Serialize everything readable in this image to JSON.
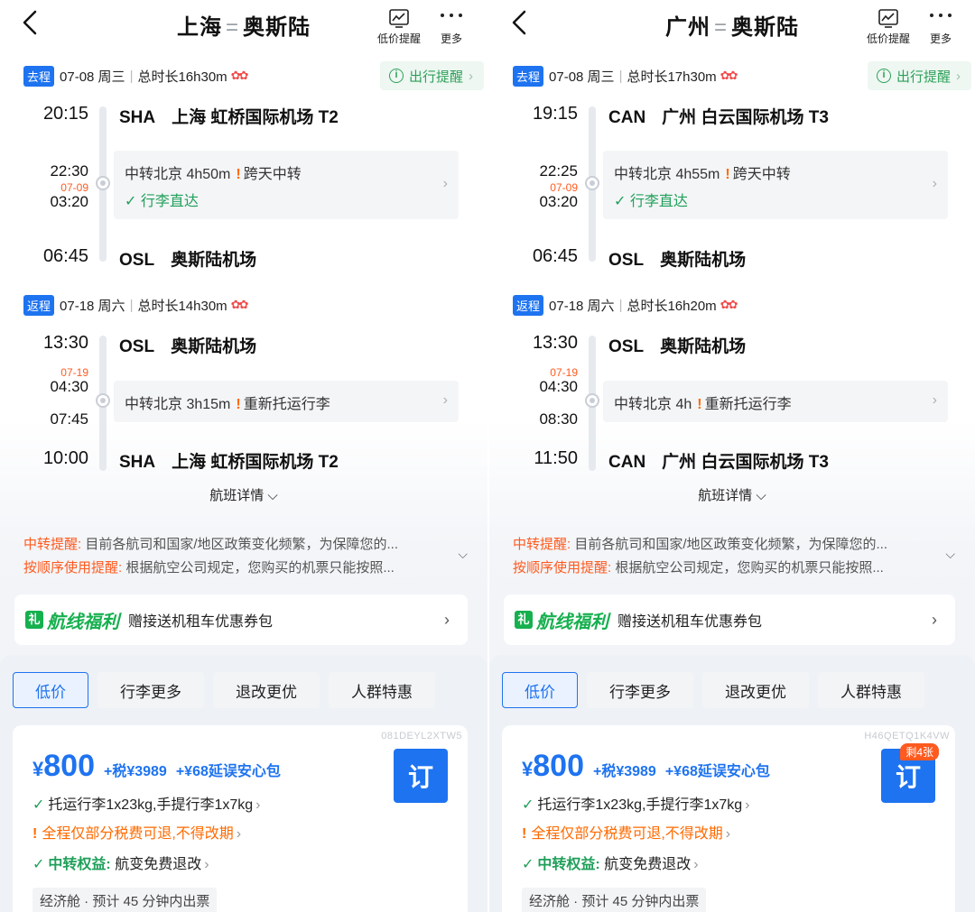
{
  "panels": [
    {
      "header": {
        "from": "上海",
        "eq": "=",
        "to": "奥斯陆",
        "price_alert": "低价提醒",
        "more": "更多"
      },
      "outbound": {
        "tag": "去程",
        "date": "07-08 周三",
        "duration": "总时长16h30m",
        "reminder": "出行提醒",
        "dep_time": "20:15",
        "dep_code": "SHA",
        "dep_airport": "上海 虹桥国际机场 T2",
        "arr_time_mid": "22:30",
        "mid_date": "07-09",
        "dep_time_mid": "03:20",
        "transfer": "中转北京 4h50m",
        "warn": "跨天中转",
        "luggage": "行李直达",
        "arr_time": "06:45",
        "arr_code": "OSL",
        "arr_airport": "奥斯陆机场"
      },
      "inbound": {
        "tag": "返程",
        "date": "07-18 周六",
        "duration": "总时长14h30m",
        "dep_time": "13:30",
        "dep_code": "OSL",
        "dep_airport": "奥斯陆机场",
        "mid_date": "07-19",
        "arr_time_mid": "04:30",
        "dep_time_mid": "07:45",
        "transfer": "中转北京 3h15m",
        "warn": "重新托运行李",
        "arr_time": "10:00",
        "arr_code": "SHA",
        "arr_airport": "上海 虹桥国际机场 T2"
      },
      "flight_detail": "航班详情",
      "notice1_hl": "中转提醒:",
      "notice1": " 目前各航司和国家/地区政策变化频繁，为保障您的...",
      "notice2_hl": "按顺序使用提醒:",
      "notice2": " 根据航空公司规定，您购买的机票只能按照...",
      "benefit_title": "航线福利",
      "benefit_desc": "赠接送机租车优惠券包",
      "tabs": [
        "低价",
        "行李更多",
        "退改更优",
        "人群特惠"
      ],
      "fare": {
        "code": "081DEYL2XTW5",
        "currency": "¥",
        "price": "800",
        "tax": "+税¥3989",
        "addon": "+¥68延误安心包",
        "book": "订",
        "badge": "",
        "baggage": "托运行李1x23kg,手提行李1x7kg",
        "refund": "全程仅部分税费可退,不得改期",
        "rights_label": "中转权益:",
        "rights": " 航变免费退改",
        "eco": "经济舱 · 预计 45 分钟内出票"
      }
    },
    {
      "header": {
        "from": "广州",
        "eq": "=",
        "to": "奥斯陆",
        "price_alert": "低价提醒",
        "more": "更多"
      },
      "outbound": {
        "tag": "去程",
        "date": "07-08 周三",
        "duration": "总时长17h30m",
        "reminder": "出行提醒",
        "dep_time": "19:15",
        "dep_code": "CAN",
        "dep_airport": "广州 白云国际机场 T3",
        "arr_time_mid": "22:25",
        "mid_date": "07-09",
        "dep_time_mid": "03:20",
        "transfer": "中转北京 4h55m",
        "warn": "跨天中转",
        "luggage": "行李直达",
        "arr_time": "06:45",
        "arr_code": "OSL",
        "arr_airport": "奥斯陆机场"
      },
      "inbound": {
        "tag": "返程",
        "date": "07-18 周六",
        "duration": "总时长16h20m",
        "dep_time": "13:30",
        "dep_code": "OSL",
        "dep_airport": "奥斯陆机场",
        "mid_date": "07-19",
        "arr_time_mid": "04:30",
        "dep_time_mid": "08:30",
        "transfer": "中转北京 4h",
        "warn": "重新托运行李",
        "arr_time": "11:50",
        "arr_code": "CAN",
        "arr_airport": "广州 白云国际机场 T3"
      },
      "flight_detail": "航班详情",
      "notice1_hl": "中转提醒:",
      "notice1": " 目前各航司和国家/地区政策变化频繁，为保障您的...",
      "notice2_hl": "按顺序使用提醒:",
      "notice2": " 根据航空公司规定，您购买的机票只能按照...",
      "benefit_title": "航线福利",
      "benefit_desc": "赠接送机租车优惠券包",
      "tabs": [
        "低价",
        "行李更多",
        "退改更优",
        "人群特惠"
      ],
      "fare": {
        "code": "H46QETQ1K4VW",
        "currency": "¥",
        "price": "800",
        "tax": "+税¥3989",
        "addon": "+¥68延误安心包",
        "book": "订",
        "badge": "剩4张",
        "baggage": "托运行李1x23kg,手提行李1x7kg",
        "refund": "全程仅部分税费可退,不得改期",
        "rights_label": "中转权益:",
        "rights": " 航变免费退改",
        "eco": "经济舱 · 预计 45 分钟内出票"
      }
    }
  ],
  "colors": {
    "accent": "#1e73f0",
    "green": "#20a05a",
    "orange": "#ff6a00",
    "red_date": "#ff5a1f"
  },
  "icons": [
    "back-arrow-icon",
    "price-alert-icon",
    "more-dots-icon",
    "info-icon",
    "check-icon",
    "warning-icon",
    "chevron-right-icon",
    "chevron-down-icon",
    "gift-icon"
  ]
}
